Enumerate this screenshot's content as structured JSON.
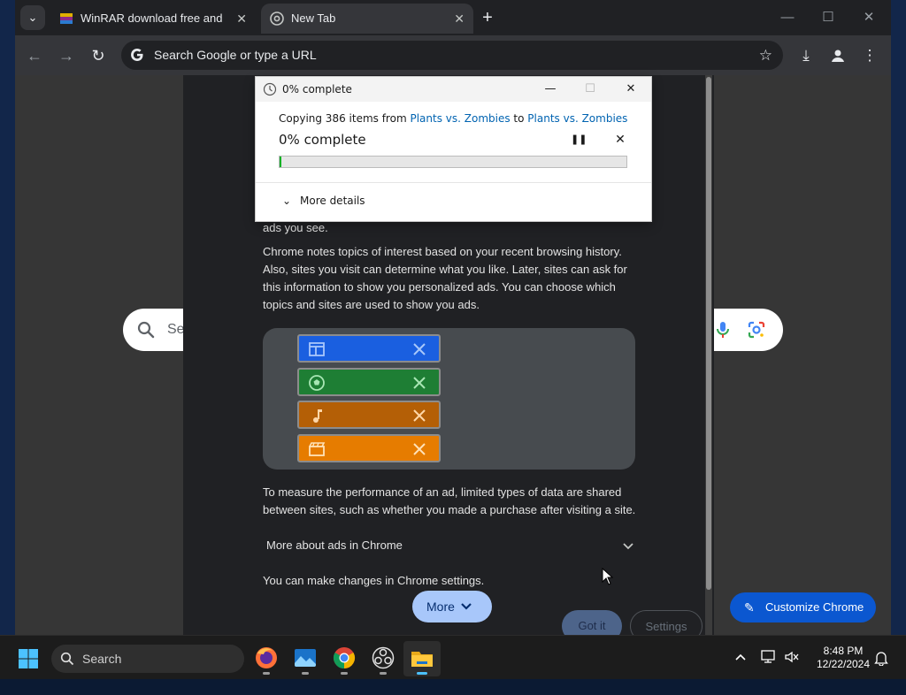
{
  "browser": {
    "tabs": [
      {
        "title": "WinRAR download free and support",
        "active": false
      },
      {
        "title": "New Tab",
        "active": true
      }
    ],
    "omnibox_placeholder": "Search Google or type a URL"
  },
  "ntp": {
    "search_placeholder": "Se",
    "customize_label": "Customize Chrome"
  },
  "privacy_dialog": {
    "partial_text": "ads you see.",
    "paragraph1": "Chrome notes topics of interest based on your recent browsing history. Also, sites you visit can determine what you like. Later, sites can ask for this information to show you personalized ads. You can choose which topics and sites are used to show you ads.",
    "paragraph2": "To measure the performance of an ad, limited types of data are shared between sites, such as whether you made a purchase after visiting a site.",
    "expander_label": "More about ads in Chrome",
    "paragraph3": "You can make changes in Chrome settings.",
    "more_button": "More",
    "got_it_button": "Got it",
    "settings_button": "Settings",
    "topic_chips": [
      {
        "icon": "web-layout-icon",
        "color": "#1a5fe0"
      },
      {
        "icon": "soccer-ball-icon",
        "color": "#1e7e34"
      },
      {
        "icon": "music-note-icon",
        "color": "#b45f06"
      },
      {
        "icon": "clapperboard-icon",
        "color": "#e67c00"
      }
    ]
  },
  "copy_dialog": {
    "title": "0% complete",
    "line_prefix": "Copying 386 items from",
    "source": "Plants vs. Zombies",
    "to_word": "to",
    "destination": "Plants vs. Zombies",
    "progress_label": "0% complete",
    "progress_fraction": 0.0,
    "more_details": "More details"
  },
  "taskbar": {
    "search_label": "Search",
    "apps": [
      "firefox-icon",
      "photos-icon",
      "chrome-icon",
      "obs-icon",
      "file-explorer-icon"
    ],
    "time": "8:48 PM",
    "date": "12/22/2024"
  }
}
